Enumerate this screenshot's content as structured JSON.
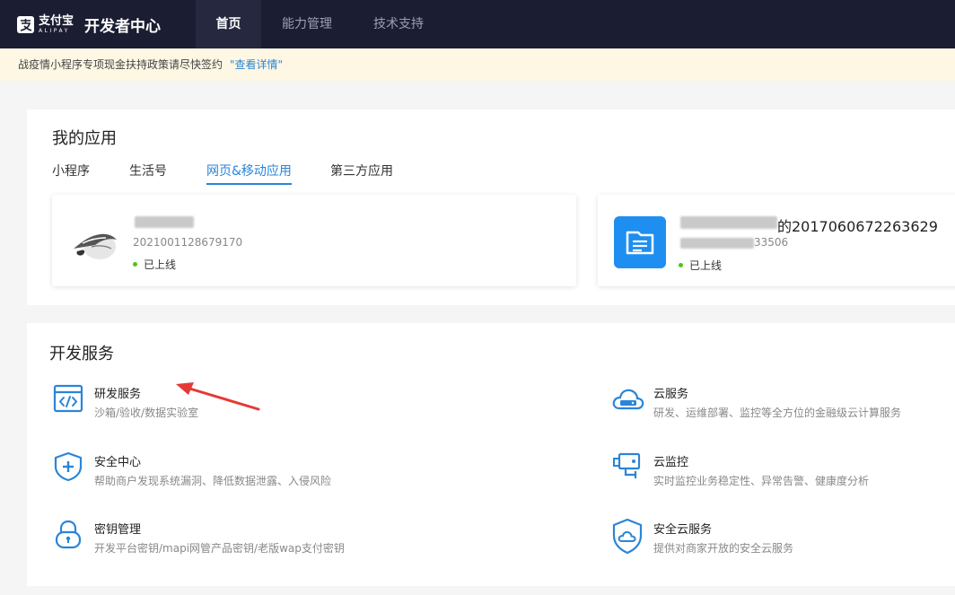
{
  "header": {
    "logo_cn": "支付宝",
    "logo_en": "ALIPAY",
    "title": "开发者中心",
    "nav": [
      "首页",
      "能力管理",
      "技术支持"
    ]
  },
  "notice": {
    "text": "战疫情小程序专项现金扶持政策请尽快签约",
    "link": "\"查看详情\""
  },
  "apps": {
    "title": "我的应用",
    "tabs": [
      "小程序",
      "生活号",
      "网页&移动应用",
      "第三方应用"
    ],
    "active_tab": 2,
    "items": [
      {
        "name": "",
        "id": "2021001128679170",
        "status": "已上线",
        "icon": "bird-app-icon"
      },
      {
        "name": "的2017060672263629",
        "id": "33506",
        "status": "已上线",
        "icon": "document-app-icon"
      }
    ]
  },
  "dev": {
    "title": "开发服务",
    "services": [
      {
        "name": "研发服务",
        "desc": "沙箱/验收/数据实验室",
        "icon": "code-window-icon"
      },
      {
        "name": "云服务",
        "desc": "研发、运维部署、监控等全方位的金融级云计算服务",
        "icon": "cloud-server-icon"
      },
      {
        "name": "安全中心",
        "desc": "帮助商户发现系统漏洞、降低数据泄露、入侵风险",
        "icon": "shield-plus-icon"
      },
      {
        "name": "云监控",
        "desc": "实时监控业务稳定性、异常告警、健康度分析",
        "icon": "monitor-camera-icon"
      },
      {
        "name": "密钥管理",
        "desc": "开发平台密钥/mapi网管产品密钥/老版wap支付密钥",
        "icon": "lock-icon"
      },
      {
        "name": "安全云服务",
        "desc": "提供对商家开放的安全云服务",
        "icon": "shield-cloud-icon"
      }
    ]
  },
  "colors": {
    "topbar": "#1b1d32",
    "accent": "#2a85d8",
    "online": "#52c41a",
    "arrow": "#e53935"
  }
}
